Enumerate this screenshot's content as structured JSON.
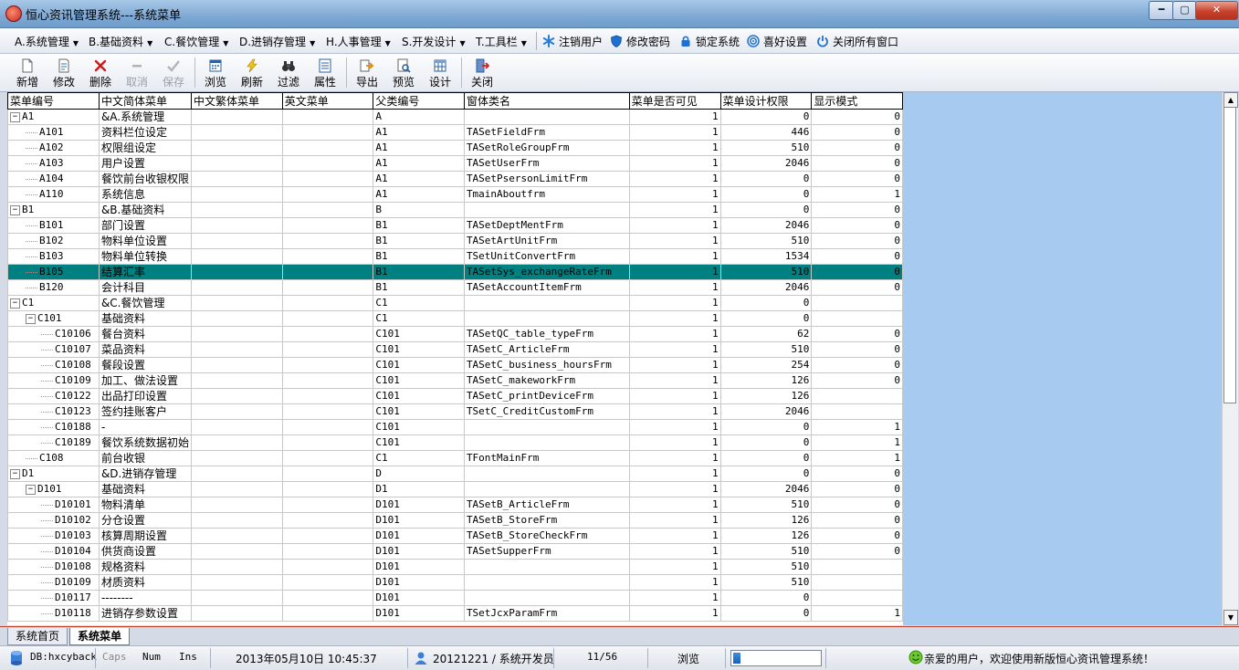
{
  "window": {
    "title": "恒心资讯管理系统---系统菜单",
    "minimize_label": "━",
    "maximize_label": "▢",
    "close_label": "✕"
  },
  "menubar": {
    "items": [
      {
        "label": "A.系统管理",
        "arrow": "▼"
      },
      {
        "label": "B.基础资料",
        "arrow": "▼"
      },
      {
        "label": "C.餐饮管理",
        "arrow": "▼"
      },
      {
        "label": "D.进销存管理",
        "arrow": "▼"
      },
      {
        "label": "H.人事管理",
        "arrow": "▼"
      },
      {
        "label": "S.开发设计",
        "arrow": "▼"
      },
      {
        "label": "T.工具栏",
        "arrow": "▼"
      }
    ],
    "actions": [
      {
        "label": "注销用户",
        "icon": "snowflake-icon"
      },
      {
        "label": "修改密码",
        "icon": "shield-icon"
      },
      {
        "label": "锁定系统",
        "icon": "lock-icon"
      },
      {
        "label": "喜好设置",
        "icon": "target-icon"
      },
      {
        "label": "关闭所有窗口",
        "icon": "power-icon"
      }
    ]
  },
  "toolbar": {
    "add": "新增",
    "edit": "修改",
    "delete": "删除",
    "cancel": "取消",
    "save": "保存",
    "browse": "浏览",
    "refresh": "刷新",
    "filter": "过滤",
    "properties": "属性",
    "export": "导出",
    "preview": "预览",
    "design": "设计",
    "close": "关闭"
  },
  "grid": {
    "columns": [
      "菜单编号",
      "中文简体菜单",
      "中文繁体菜单",
      "英文菜单",
      "父类编号",
      "窗体类名",
      "菜单是否可见",
      "菜单设计权限",
      "显示模式"
    ],
    "rows": [
      {
        "code": "A1",
        "level": 0,
        "toggle": "−",
        "cn": "&A.系统管理",
        "parent": "A",
        "form": "",
        "visible": "1",
        "perm": "0",
        "mode": "0"
      },
      {
        "code": "A101",
        "level": 1,
        "toggle": "",
        "cn": "资料栏位设定",
        "parent": "A1",
        "form": "TASetFieldFrm",
        "visible": "1",
        "perm": "446",
        "mode": "0"
      },
      {
        "code": "A102",
        "level": 1,
        "toggle": "",
        "cn": "权限组设定",
        "parent": "A1",
        "form": "TASetRoleGroupFrm",
        "visible": "1",
        "perm": "510",
        "mode": "0"
      },
      {
        "code": "A103",
        "level": 1,
        "toggle": "",
        "cn": "用户设置",
        "parent": "A1",
        "form": "TASetUserFrm",
        "visible": "1",
        "perm": "2046",
        "mode": "0"
      },
      {
        "code": "A104",
        "level": 1,
        "toggle": "",
        "cn": "餐饮前台收银权限",
        "parent": "A1",
        "form": "TASetPsersonLimitFrm",
        "visible": "1",
        "perm": "0",
        "mode": "0"
      },
      {
        "code": "A110",
        "level": 1,
        "toggle": "",
        "cn": "系统信息",
        "parent": "A1",
        "form": "TmainAboutfrm",
        "visible": "1",
        "perm": "0",
        "mode": "1"
      },
      {
        "code": "B1",
        "level": 0,
        "toggle": "−",
        "cn": "&B.基础资料",
        "parent": "B",
        "form": "",
        "visible": "1",
        "perm": "0",
        "mode": "0"
      },
      {
        "code": "B101",
        "level": 1,
        "toggle": "",
        "cn": "部门设置",
        "parent": "B1",
        "form": "TASetDeptMentFrm",
        "visible": "1",
        "perm": "2046",
        "mode": "0"
      },
      {
        "code": "B102",
        "level": 1,
        "toggle": "",
        "cn": "物料单位设置",
        "parent": "B1",
        "form": "TASetArtUnitFrm",
        "visible": "1",
        "perm": "510",
        "mode": "0"
      },
      {
        "code": "B103",
        "level": 1,
        "toggle": "",
        "cn": "物料单位转换",
        "parent": "B1",
        "form": "TSetUnitConvertFrm",
        "visible": "1",
        "perm": "1534",
        "mode": "0"
      },
      {
        "code": "B105",
        "level": 1,
        "toggle": "",
        "cn": "结算汇率",
        "parent": "B1",
        "form": "TASetSys_exchangeRateFrm",
        "visible": "1",
        "perm": "510",
        "mode": "0",
        "selected": true
      },
      {
        "code": "B120",
        "level": 1,
        "toggle": "",
        "cn": "会计科目",
        "parent": "B1",
        "form": "TASetAccountItemFrm",
        "visible": "1",
        "perm": "2046",
        "mode": "0"
      },
      {
        "code": "C1",
        "level": 0,
        "toggle": "−",
        "cn": "&C.餐饮管理",
        "parent": "C1",
        "form": "",
        "visible": "1",
        "perm": "0",
        "mode": ""
      },
      {
        "code": "C101",
        "level": 1,
        "toggle": "−",
        "cn": "基础资料",
        "parent": "C1",
        "form": "",
        "visible": "1",
        "perm": "0",
        "mode": ""
      },
      {
        "code": "C10106",
        "level": 2,
        "toggle": "",
        "cn": "餐台资料",
        "parent": "C101",
        "form": "TASetQC_table_typeFrm",
        "visible": "1",
        "perm": "62",
        "mode": "0"
      },
      {
        "code": "C10107",
        "level": 2,
        "toggle": "",
        "cn": "菜品资料",
        "parent": "C101",
        "form": "TASetC_ArticleFrm",
        "visible": "1",
        "perm": "510",
        "mode": "0"
      },
      {
        "code": "C10108",
        "level": 2,
        "toggle": "",
        "cn": "餐段设置",
        "parent": "C101",
        "form": "TASetC_business_hoursFrm",
        "visible": "1",
        "perm": "254",
        "mode": "0"
      },
      {
        "code": "C10109",
        "level": 2,
        "toggle": "",
        "cn": "加工、做法设置",
        "parent": "C101",
        "form": "TASetC_makeworkFrm",
        "visible": "1",
        "perm": "126",
        "mode": "0"
      },
      {
        "code": "C10122",
        "level": 2,
        "toggle": "",
        "cn": "出品打印设置",
        "parent": "C101",
        "form": "TASetC_printDeviceFrm",
        "visible": "1",
        "perm": "126",
        "mode": ""
      },
      {
        "code": "C10123",
        "level": 2,
        "toggle": "",
        "cn": "签约挂账客户",
        "parent": "C101",
        "form": "TSetC_CreditCustomFrm",
        "visible": "1",
        "perm": "2046",
        "mode": ""
      },
      {
        "code": "C10188",
        "level": 2,
        "toggle": "",
        "cn": "-",
        "parent": "C101",
        "form": "",
        "visible": "1",
        "perm": "0",
        "mode": "1"
      },
      {
        "code": "C10189",
        "level": 2,
        "toggle": "",
        "cn": "餐饮系统数据初始",
        "parent": "C101",
        "form": "",
        "visible": "1",
        "perm": "0",
        "mode": "1"
      },
      {
        "code": "C108",
        "level": 1,
        "toggle": "",
        "cn": "前台收银",
        "parent": "C1",
        "form": "TFontMainFrm",
        "visible": "1",
        "perm": "0",
        "mode": "1"
      },
      {
        "code": "D1",
        "level": 0,
        "toggle": "−",
        "cn": "&D.进销存管理",
        "parent": "D",
        "form": "",
        "visible": "1",
        "perm": "0",
        "mode": "0"
      },
      {
        "code": "D101",
        "level": 1,
        "toggle": "−",
        "cn": "基础资料",
        "parent": "D1",
        "form": "",
        "visible": "1",
        "perm": "2046",
        "mode": "0"
      },
      {
        "code": "D10101",
        "level": 2,
        "toggle": "",
        "cn": "物料清单",
        "parent": "D101",
        "form": "TASetB_ArticleFrm",
        "visible": "1",
        "perm": "510",
        "mode": "0"
      },
      {
        "code": "D10102",
        "level": 2,
        "toggle": "",
        "cn": "分仓设置",
        "parent": "D101",
        "form": "TASetB_StoreFrm",
        "visible": "1",
        "perm": "126",
        "mode": "0"
      },
      {
        "code": "D10103",
        "level": 2,
        "toggle": "",
        "cn": "核算周期设置",
        "parent": "D101",
        "form": "TASetB_StoreCheckFrm",
        "visible": "1",
        "perm": "126",
        "mode": "0"
      },
      {
        "code": "D10104",
        "level": 2,
        "toggle": "",
        "cn": "供货商设置",
        "parent": "D101",
        "form": "TASetSupperFrm",
        "visible": "1",
        "perm": "510",
        "mode": "0"
      },
      {
        "code": "D10108",
        "level": 2,
        "toggle": "",
        "cn": "规格资料",
        "parent": "D101",
        "form": "",
        "visible": "1",
        "perm": "510",
        "mode": ""
      },
      {
        "code": "D10109",
        "level": 2,
        "toggle": "",
        "cn": "材质资料",
        "parent": "D101",
        "form": "",
        "visible": "1",
        "perm": "510",
        "mode": ""
      },
      {
        "code": "D10117",
        "level": 2,
        "toggle": "",
        "cn": "--------",
        "parent": "D101",
        "form": "",
        "visible": "1",
        "perm": "0",
        "mode": ""
      },
      {
        "code": "D10118",
        "level": 2,
        "toggle": "",
        "cn": "进销存参数设置",
        "parent": "D101",
        "form": "TSetJcxParamFrm",
        "visible": "1",
        "perm": "0",
        "mode": "1"
      }
    ]
  },
  "tabs": {
    "home": "系统首页",
    "menu": "系统菜单"
  },
  "status": {
    "db": "DB:hxcyback",
    "caps": "Caps",
    "num": "Num",
    "ins": "Ins",
    "datetime": "2013年05月10日 10:45:37",
    "user": "20121221 / 系统开发员",
    "record": "11/56",
    "mode": "浏览",
    "progress": 0.08,
    "welcome": "亲爱的用户，欢迎使用新版恒心资讯管理系统！"
  },
  "colors": {
    "selected_row": "#008080",
    "grid_blank": "#a6caf0"
  }
}
